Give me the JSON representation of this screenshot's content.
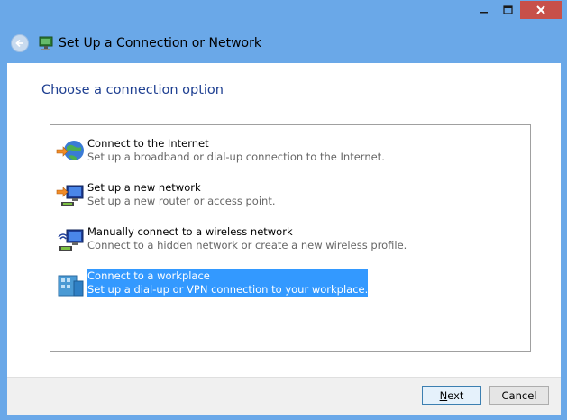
{
  "window": {
    "title": "Set Up a Connection or Network",
    "controls": {
      "minimize": "–",
      "maximize": "□",
      "close": "✕"
    }
  },
  "main": {
    "heading": "Choose a connection option",
    "options": [
      {
        "title": "Connect to the Internet",
        "description": "Set up a broadband or dial-up connection to the Internet.",
        "icon": "globe-internet-icon",
        "selected": false
      },
      {
        "title": "Set up a new network",
        "description": "Set up a new router or access point.",
        "icon": "new-network-icon",
        "selected": false
      },
      {
        "title": "Manually connect to a wireless network",
        "description": "Connect to a hidden network or create a new wireless profile.",
        "icon": "wireless-network-icon",
        "selected": false
      },
      {
        "title": "Connect to a workplace",
        "description": "Set up a dial-up or VPN connection to your workplace.",
        "icon": "workplace-icon",
        "selected": true
      }
    ]
  },
  "footer": {
    "next_label_first": "N",
    "next_label_rest": "ext",
    "cancel_label": "Cancel"
  },
  "colors": {
    "frame": "#6aa8e8",
    "heading": "#1e3f91",
    "selection": "#3399ff",
    "close_button": "#c7504a"
  }
}
